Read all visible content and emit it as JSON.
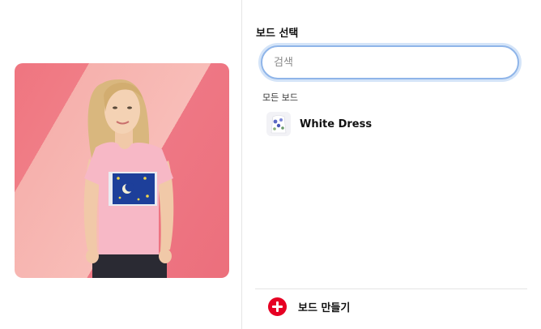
{
  "panel": {
    "title": "보드 선택",
    "search_placeholder": "검색",
    "section_label": "모든 보드",
    "create_label": "보드 만들기"
  },
  "boards": [
    {
      "name": "White Dress"
    }
  ],
  "colors": {
    "accent_red": "#e60023",
    "search_focus_ring": "#8fb5e9",
    "pin_background": "#f6b1ad"
  },
  "icons": {
    "create": "plus-circle-icon"
  }
}
